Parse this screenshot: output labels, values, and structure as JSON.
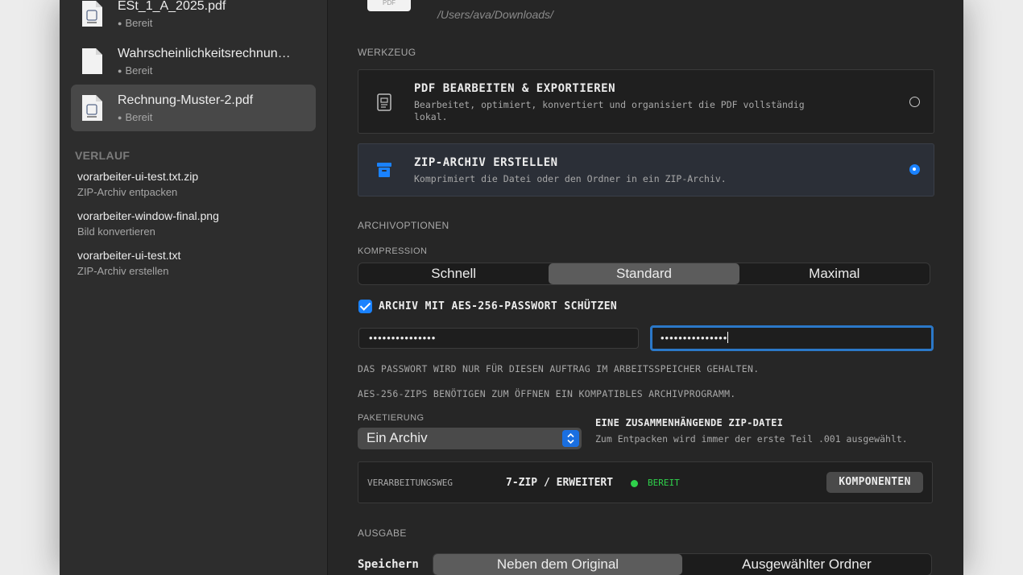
{
  "sidebar": {
    "files": [
      {
        "name": "ESt_1_A_2025.pdf",
        "status": "Bereit"
      },
      {
        "name": "Wahrscheinlichkeitsrechnun…",
        "status": "Bereit"
      },
      {
        "name": "Rechnung-Muster-2.pdf",
        "status": "Bereit"
      }
    ],
    "history_heading": "VERLAUF",
    "history": [
      {
        "title": "vorarbeiter-ui-test.txt.zip",
        "subtitle": "ZIP-Archiv entpacken"
      },
      {
        "title": "vorarbeiter-window-final.png",
        "subtitle": "Bild konvertieren"
      },
      {
        "title": "vorarbeiter-ui-test.txt",
        "subtitle": "ZIP-Archiv erstellen"
      }
    ]
  },
  "header": {
    "thumb_label": "PDF",
    "path": "/Users/ava/Downloads/"
  },
  "tools": {
    "heading": "WERKZEUG",
    "items": [
      {
        "title": "PDF BEARBEITEN & EXPORTIEREN",
        "desc": "Bearbeitet, optimiert, konvertiert und organisiert die PDF vollständig lokal.",
        "selected": false
      },
      {
        "title": "ZIP-ARCHIV ERSTELLEN",
        "desc": "Komprimiert die Datei oder den Ordner in ein ZIP-Archiv.",
        "selected": true
      }
    ]
  },
  "archive": {
    "heading": "ARCHIVOPTIONEN",
    "compression_label": "KOMPRESSION",
    "compression_options": [
      "Schnell",
      "Standard",
      "Maximal"
    ],
    "compression_selected": "Standard",
    "password_checkbox_label": "ARCHIV MIT AES-256-PASSWORT SCHÜTZEN",
    "password_checked": true,
    "password_value": "•••••••••••••••",
    "password_confirm_value": "•••••••••••••••",
    "note_memory": "DAS PASSWORT WIRD NUR FÜR DIESEN AUFTRAG IM ARBEITSSPEICHER GEHALTEN.",
    "note_aes": "AES-256-ZIPS BENÖTIGEN ZUM ÖFFNEN EIN KOMPATIBLES ARCHIVPROGRAMM.",
    "packaging_label": "PAKETIERUNG",
    "packaging_value": "Ein Archiv",
    "packaging_info_title": "EINE ZUSAMMENHÄNGENDE ZIP-DATEI",
    "packaging_info_desc": "Zum Entpacken wird immer der erste Teil .001 ausgewählt."
  },
  "processing": {
    "label": "VERARBEITUNGSWEG",
    "engine": "7-ZIP / ERWEITERT",
    "status": "BEREIT",
    "button": "KOMPONENTEN"
  },
  "output": {
    "heading": "AUSGABE",
    "save_label": "Speichern",
    "options": [
      "Neben dem Original",
      "Ausgewählter Ordner"
    ],
    "selected": "Neben dem Original"
  },
  "colors": {
    "accent": "#1a82ff",
    "status_green": "#2fd14b"
  }
}
